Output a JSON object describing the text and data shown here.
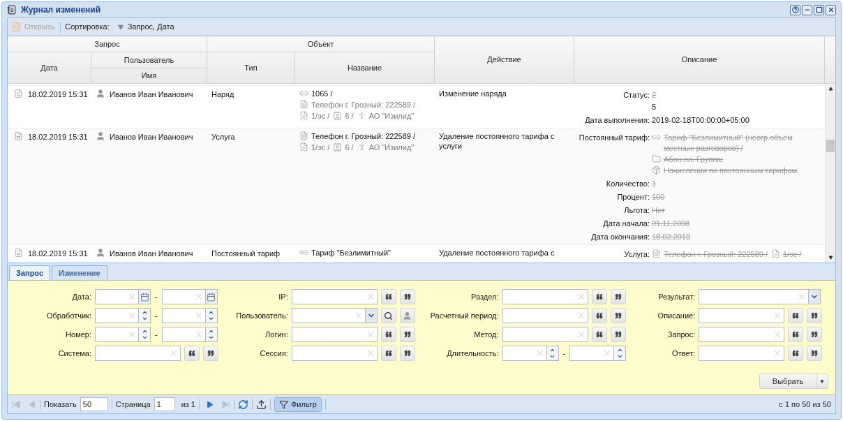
{
  "window": {
    "title": "Журнал изменений"
  },
  "toolbar": {
    "open": {
      "label": "Открыть",
      "disabled": true
    },
    "sort_label": "Сортировка:",
    "sort_value": "Запрос, Дата"
  },
  "table": {
    "group_headers": [
      "Запрос",
      "Объект"
    ],
    "columns": {
      "date": "Дата",
      "user_group": "Пользователь",
      "user_name": "Имя",
      "type": "Тип",
      "name": "Название",
      "action": "Действие",
      "description": "Описание"
    },
    "rows": [
      {
        "date": "18.02.2019 15:31",
        "user": "Иванов Иван Иванович",
        "type": "Наряд",
        "name": [
          {
            "kind": "link",
            "text": "1065 /",
            "primary": true
          },
          {
            "kind": "doc",
            "text": "Телефон г. Грозный: 222589 /",
            "primary": false
          },
          {
            "kind": "edit",
            "text": "1/эс /",
            "primary": false
          },
          {
            "kind": "card",
            "text": "6 /",
            "primary": false
          },
          {
            "kind": "figure",
            "text": "АО \"Изилид\"",
            "primary": false
          }
        ],
        "action": "Изменение наряда",
        "fields": [
          {
            "label": "Статус:",
            "old": [
              {
                "text": "2"
              }
            ],
            "new": [
              {
                "text": "5"
              }
            ]
          },
          {
            "label": "Дата выполнения:",
            "new": [
              {
                "text": "2019-02-18T00:00:00+05:00"
              }
            ]
          }
        ]
      },
      {
        "date": "18.02.2019 15:31",
        "user": "Иванов Иван Иванович",
        "type": "Услуга",
        "name": [
          {
            "kind": "doc",
            "text": "Телефон г. Грозный: 222589 /",
            "primary": true
          },
          {
            "kind": "edit",
            "text": "1/эс /",
            "primary": false
          },
          {
            "kind": "card",
            "text": "6 /",
            "primary": false
          },
          {
            "kind": "figure",
            "text": "АО \"Изилид\"",
            "primary": false
          }
        ],
        "action": "Удаление постоянного тарифа с услуги",
        "fields": [
          {
            "label": "Постоянный тариф:",
            "old": [
              {
                "kind": "link",
                "text": "Тариф \"Безлимитный\" (неогр.объем местных разговоров) /"
              },
              {
                "kind": "folder",
                "text": "Абон.пл. Группа:"
              },
              {
                "kind": "box",
                "text": "Начисления по постоянным тарифам"
              }
            ]
          },
          {
            "label": "Количество:",
            "old": [
              {
                "text": "1"
              }
            ]
          },
          {
            "label": "Процент:",
            "old": [
              {
                "text": "100"
              }
            ]
          },
          {
            "label": "Льгота:",
            "old": [
              {
                "text": "Нет"
              }
            ]
          },
          {
            "label": "Дата начала:",
            "old": [
              {
                "text": "01.11.2008"
              }
            ]
          },
          {
            "label": "Дата окончания:",
            "old": [
              {
                "text": "18.02.2019"
              }
            ]
          }
        ]
      },
      {
        "date": "18.02.2019 15:31",
        "user": "Иванов Иван Иванович",
        "type": "Постоянный тариф",
        "name": [
          {
            "kind": "link",
            "text": "Тариф \"Безлимитный\"",
            "primary": true
          }
        ],
        "action": "Удаление постоянного тарифа с",
        "fields": [
          {
            "label": "Услуга:",
            "old": [
              {
                "kind": "doc",
                "text": "Телефон г. Грозный: 222589 /"
              },
              {
                "kind": "edit",
                "text": "1/эс /"
              }
            ]
          }
        ]
      }
    ]
  },
  "tabs": [
    {
      "label": "Запрос",
      "selected": true
    },
    {
      "label": "Изменение",
      "selected": false
    }
  ],
  "filter_form": {
    "columns": [
      [
        {
          "label": "Дата:",
          "kind": "date-range"
        },
        {
          "label": "Обработчик:",
          "kind": "spin-range"
        },
        {
          "label": "Номер:",
          "kind": "spin-range"
        },
        {
          "label": "Система:",
          "kind": "text"
        }
      ],
      [
        {
          "label": "IP:",
          "kind": "text"
        },
        {
          "label": "Пользователь:",
          "kind": "lookup"
        },
        {
          "label": "Логин:",
          "kind": "text"
        },
        {
          "label": "Сессия:",
          "kind": "text"
        }
      ],
      [
        {
          "label": "Раздел:",
          "kind": "text"
        },
        {
          "label": "Расчетный период:",
          "kind": "text"
        },
        {
          "label": "Метод:",
          "kind": "text"
        },
        {
          "label": "Длительность:",
          "kind": "spin-range"
        }
      ],
      [
        {
          "label": "Результат:",
          "kind": "select"
        },
        {
          "label": "Описание:",
          "kind": "text"
        },
        {
          "label": "Запрос:",
          "kind": "text"
        },
        {
          "label": "Ответ:",
          "kind": "text"
        }
      ]
    ],
    "range_separator": "-",
    "submit": "Выбрать"
  },
  "pager": {
    "show_label": "Показать",
    "page_size": "50",
    "page_label": "Страница",
    "page": "1",
    "page_count": "из 1",
    "filter_label": "Фильтр",
    "filter_on": true,
    "summary": "с 1 по 50 из 50"
  }
}
